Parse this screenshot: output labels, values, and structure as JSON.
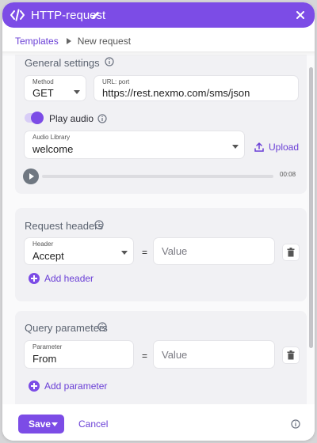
{
  "window": {
    "title": "HTTP-request"
  },
  "breadcrumb": {
    "parent": "Templates",
    "current": "New request"
  },
  "general": {
    "title": "General settings",
    "method": {
      "label": "Method",
      "value": "GET"
    },
    "url": {
      "label": "URL: port",
      "value": "https://rest.nexmo.com/sms/json"
    },
    "play_audio": {
      "label": "Play audio",
      "checked": true
    },
    "audio_library": {
      "label": "Audio Library",
      "value": "welcome"
    },
    "upload_label": "Upload",
    "player": {
      "time": "00:08",
      "progress": 0
    }
  },
  "headers": {
    "title": "Request headers",
    "field_label": "Header",
    "key": "Accept",
    "equals": "=",
    "value_placeholder": "Value",
    "add_label": "Add header"
  },
  "query": {
    "title": "Query parameters",
    "field_label": "Parameter",
    "key": "From",
    "equals": "=",
    "value_placeholder": "Value",
    "add_label": "Add parameter"
  },
  "footer": {
    "save_label": "Save",
    "cancel_label": "Cancel"
  },
  "colors": {
    "accent": "#7c4ce6",
    "card": "#f1f1f4"
  },
  "icons": [
    "code-icon",
    "edit-icon",
    "close-icon",
    "chevron-right-icon",
    "info-icon",
    "upload-icon",
    "play-icon",
    "trash-icon",
    "plus-icon",
    "chevron-down-icon"
  ]
}
